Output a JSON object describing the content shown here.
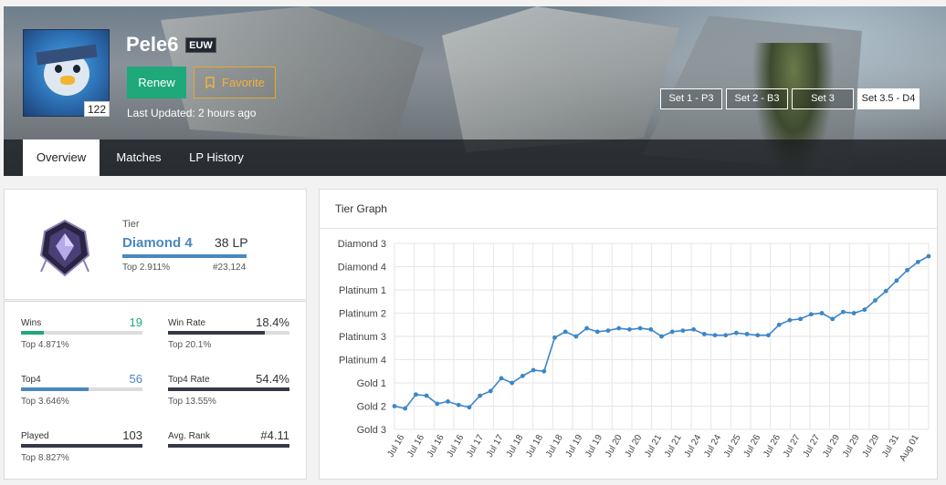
{
  "header": {
    "summoner_name": "Pele6",
    "region": "EUW",
    "level": "122",
    "renew_label": "Renew",
    "favorite_label": "Favorite",
    "last_updated": "Last Updated: 2 hours ago",
    "sets": [
      "Set 1 - P3",
      "Set 2 - B3",
      "Set 3",
      "Set 3.5 - D4"
    ],
    "active_set": 3
  },
  "tabs": [
    "Overview",
    "Matches",
    "LP History"
  ],
  "rank": {
    "tier_label": "Tier",
    "tier": "Diamond 4",
    "lp": "38 LP",
    "lp_fraction": 0.38,
    "top_percent": "Top 2.911%",
    "position": "#23,124"
  },
  "stats": [
    {
      "label": "Wins",
      "value": "19",
      "sub": "Top 4.871%",
      "fill": 0.19,
      "color": "#1fa87a",
      "value_color": "#1fa87a"
    },
    {
      "label": "Win Rate",
      "value": "18.4%",
      "sub": "Top 20.1%",
      "fill": 0.8,
      "color": "#333a44",
      "value_color": "#333333"
    },
    {
      "label": "Top4",
      "value": "56",
      "sub": "Top 3.646%",
      "fill": 0.56,
      "color": "#4a87c0",
      "value_color": "#4a87c0"
    },
    {
      "label": "Top4 Rate",
      "value": "54.4%",
      "sub": "Top 13.55%",
      "fill": 1.0,
      "color": "#333a44",
      "value_color": "#333333"
    },
    {
      "label": "Played",
      "value": "103",
      "sub": "Top 8.827%",
      "fill": 1.0,
      "color": "#333a44",
      "value_color": "#333333"
    },
    {
      "label": "Avg. Rank",
      "value": "#4.11",
      "sub": "",
      "fill": 1.0,
      "color": "#333a44",
      "value_color": "#333333"
    }
  ],
  "graph": {
    "title": "Tier Graph",
    "line_color": "#3b86c8"
  },
  "chart_data": {
    "type": "line",
    "y_ticks": [
      "Diamond 3",
      "Diamond 4",
      "Platinum 1",
      "Platinum 2",
      "Platinum 3",
      "Platinum 4",
      "Gold 1",
      "Gold 2",
      "Gold 3"
    ],
    "x_ticks": [
      "Jul 16",
      "Jul 16",
      "Jul 16",
      "Jul 16",
      "Jul 17",
      "Jul 17",
      "Jul 18",
      "Jul 18",
      "Jul 18",
      "Jul 19",
      "Jul 19",
      "Jul 20",
      "Jul 20",
      "Jul 21",
      "Jul 21",
      "Jul 24",
      "Jul 24",
      "Jul 25",
      "Jul 26",
      "Jul 26",
      "Jul 27",
      "Jul 27",
      "Jul 29",
      "Jul 29",
      "Jul 29",
      "Jul 31",
      "Aug 01"
    ],
    "ylim": [
      0,
      8
    ],
    "values": [
      1.0,
      0.9,
      1.5,
      1.45,
      1.1,
      1.2,
      1.05,
      0.95,
      1.45,
      1.65,
      2.2,
      2.0,
      2.3,
      2.55,
      2.5,
      3.95,
      4.2,
      4.0,
      4.35,
      4.2,
      4.25,
      4.35,
      4.3,
      4.35,
      4.3,
      4.0,
      4.2,
      4.25,
      4.3,
      4.1,
      4.05,
      4.05,
      4.15,
      4.1,
      4.05,
      4.05,
      4.5,
      4.7,
      4.75,
      4.95,
      5.0,
      4.75,
      5.05,
      5.0,
      5.15,
      5.55,
      5.95,
      6.4,
      6.85,
      7.2,
      7.45
    ]
  }
}
